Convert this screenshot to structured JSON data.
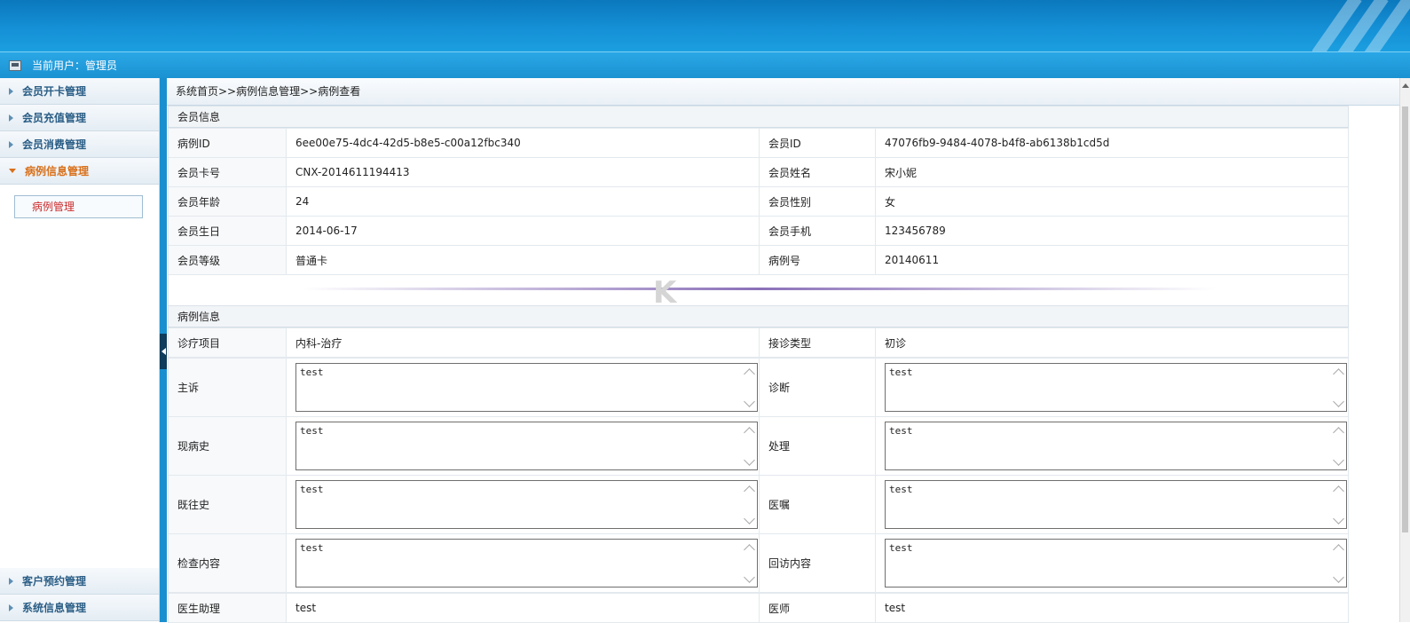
{
  "user_bar": {
    "label": "当前用户：管理员"
  },
  "sidebar": {
    "items": [
      {
        "label": "会员开卡管理"
      },
      {
        "label": "会员充值管理"
      },
      {
        "label": "会员消费管理"
      },
      {
        "label": "病例信息管理",
        "active": true
      }
    ],
    "submenu": [
      {
        "label": "病例管理",
        "active": true
      }
    ],
    "bottom_items": [
      {
        "label": "客户预约管理"
      },
      {
        "label": "系统信息管理"
      }
    ]
  },
  "breadcrumb": "系统首页>>病例信息管理>>病例查看",
  "member_section": {
    "title": "会员信息",
    "rows": [
      {
        "l1": "病例ID",
        "v1": "6ee00e75-4dc4-42d5-b8e5-c00a12fbc340",
        "l2": "会员ID",
        "v2": "47076fb9-9484-4078-b4f8-ab6138b1cd5d"
      },
      {
        "l1": "会员卡号",
        "v1": "CNX-2014611194413",
        "l2": "会员姓名",
        "v2": "宋小妮"
      },
      {
        "l1": "会员年龄",
        "v1": "24",
        "l2": "会员性别",
        "v2": "女"
      },
      {
        "l1": "会员生日",
        "v1": "2014-06-17",
        "l2": "会员手机",
        "v2": "123456789"
      },
      {
        "l1": "会员等级",
        "v1": "普通卡",
        "l2": "病例号",
        "v2": "20140611"
      }
    ]
  },
  "case_section": {
    "title": "病例信息",
    "top_row": {
      "l1": "诊疗项目",
      "v1": "内科-治疗",
      "l2": "接诊类型",
      "v2": "初诊"
    },
    "text_rows": [
      {
        "l1": "主诉",
        "v1": "test",
        "l2": "诊断",
        "v2": "test"
      },
      {
        "l1": "现病史",
        "v1": "test",
        "l2": "处理",
        "v2": "test"
      },
      {
        "l1": "既往史",
        "v1": "test",
        "l2": "医嘱",
        "v2": "test"
      },
      {
        "l1": "检查内容",
        "v1": "test",
        "l2": "回访内容",
        "v2": "test"
      }
    ],
    "bottom_row": {
      "l1": "医生助理",
      "v1": "test",
      "l2": "医师",
      "v2": "test"
    }
  },
  "watermark": "K"
}
